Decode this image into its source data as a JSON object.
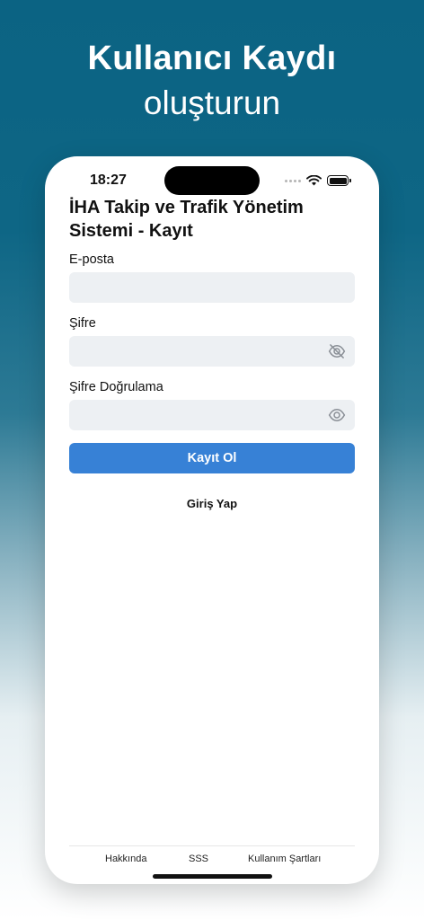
{
  "headline": {
    "line1": "Kullanıcı Kaydı",
    "line2": "oluşturun"
  },
  "status_bar": {
    "time": "18:27",
    "icons": [
      "signal-dots-icon",
      "wifi-icon",
      "battery-icon"
    ]
  },
  "form": {
    "title": "İHA Takip ve Trafik Yönetim Sistemi - Kayıt",
    "email_label": "E-posta",
    "email_value": "",
    "password_label": "Şifre",
    "password_value": "",
    "password_icon": "eye-slash-icon",
    "confirm_label": "Şifre Doğrulama",
    "confirm_value": "",
    "confirm_icon": "eye-icon",
    "submit_label": "Kayıt Ol",
    "login_link": "Giriş Yap"
  },
  "footer": {
    "about": "Hakkında",
    "faq": "SSS",
    "terms": "Kullanım Şartları"
  },
  "colors": {
    "background_top": "#0b6383",
    "primary_button": "#3781d6",
    "input_background": "#edf0f3"
  }
}
